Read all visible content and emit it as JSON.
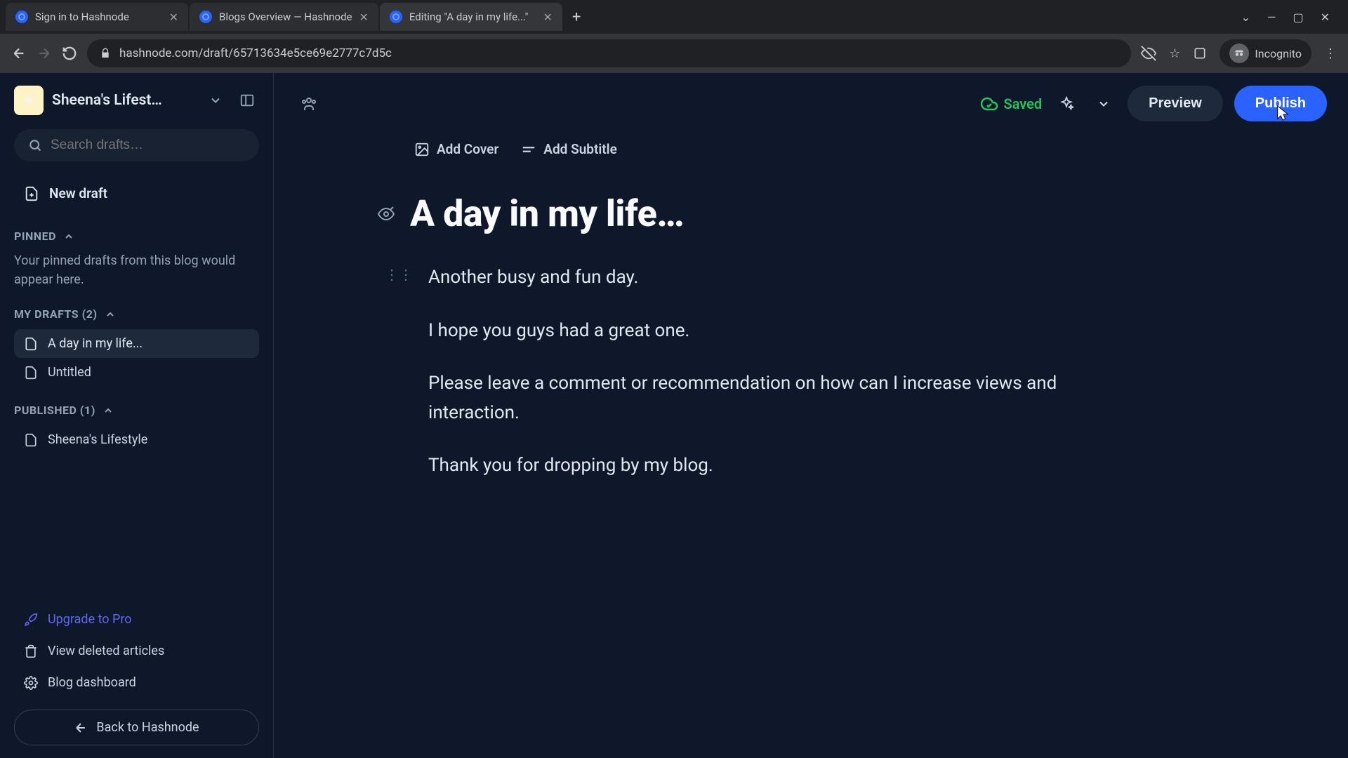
{
  "browser": {
    "tabs": [
      {
        "title": "Sign in to Hashnode"
      },
      {
        "title": "Blogs Overview — Hashnode"
      },
      {
        "title": "Editing \"A day in my life...\""
      }
    ],
    "url": "hashnode.com/draft/65713634e5ce69e2777c7d5c",
    "incognito_label": "Incognito"
  },
  "sidebar": {
    "blog_name": "Sheena's Lifest…",
    "search_placeholder": "Search drafts…",
    "new_draft_label": "New draft",
    "pinned_label": "PINNED",
    "pinned_empty": "Your pinned drafts from this blog would appear here.",
    "my_drafts_label": "MY DRAFTS (2)",
    "drafts": [
      {
        "title": "A day in my life..."
      },
      {
        "title": "Untitled"
      }
    ],
    "published_label": "PUBLISHED (1)",
    "published": [
      {
        "title": "Sheena's Lifestyle"
      }
    ],
    "upgrade_label": "Upgrade to Pro",
    "deleted_label": "View deleted articles",
    "dashboard_label": "Blog dashboard",
    "back_label": "Back to Hashnode"
  },
  "editor": {
    "saved_label": "Saved",
    "preview_label": "Preview",
    "publish_label": "Publish",
    "add_cover_label": "Add Cover",
    "add_subtitle_label": "Add Subtitle",
    "title": "A day in my life…",
    "paragraphs": [
      "Another busy and fun day.",
      "I hope you guys had a great one.",
      "Please leave a comment or recommendation on how can I increase views and interaction.",
      "Thank you for dropping by my blog."
    ]
  }
}
